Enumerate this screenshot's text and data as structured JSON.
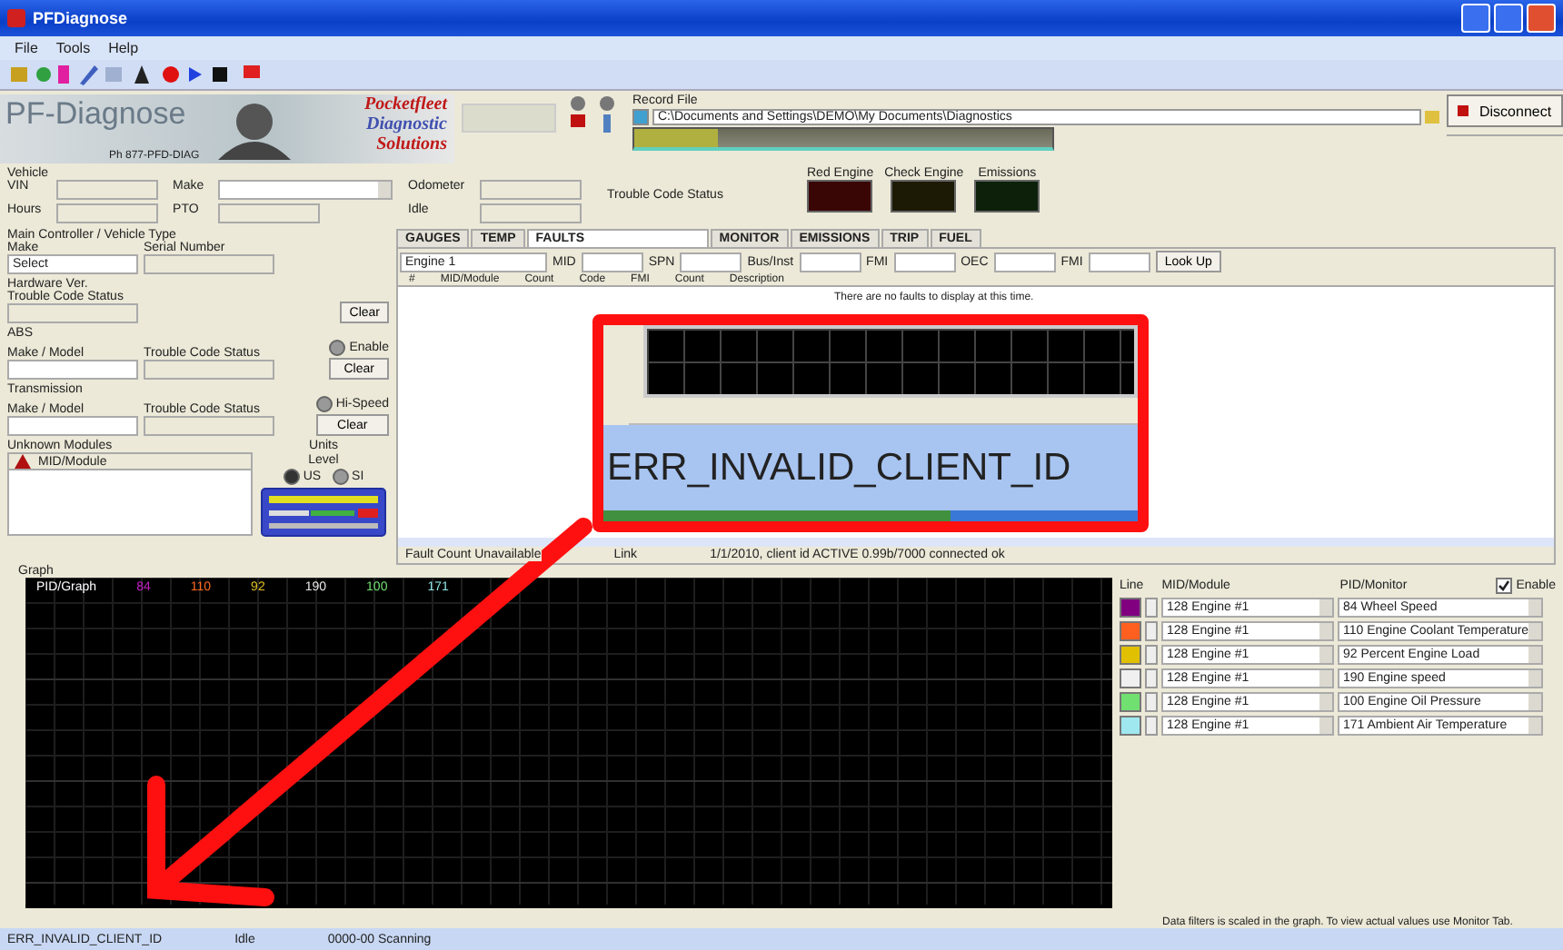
{
  "window": {
    "title": "PFDiagnose"
  },
  "menu": [
    "File",
    "Tools",
    "Help"
  ],
  "logo": {
    "title": "PF-Diagnose",
    "brand": [
      "Pocketfleet",
      "Diagnostic",
      "Solutions"
    ],
    "phone": "Ph 877-PFD-DIAG"
  },
  "record": {
    "label": "Record File",
    "checked": true,
    "path": "C:\\Documents and Settings\\DEMO\\My Documents\\Diagnostics",
    "level": 0.2
  },
  "disconnect_button": "Disconnect",
  "vehicle": {
    "group": "Vehicle",
    "fields": [
      {
        "label": "VIN",
        "kind": "text"
      },
      {
        "label": "Make",
        "kind": "select"
      },
      {
        "label": "Odometer",
        "kind": "text"
      },
      {
        "label": "Hours",
        "kind": "text"
      },
      {
        "label": "PTO",
        "kind": "text"
      },
      {
        "label": "Idle",
        "kind": "text"
      }
    ],
    "status_label": "Trouble Code Status"
  },
  "lamps": [
    {
      "label": "Red Engine",
      "color": "#3a0505"
    },
    {
      "label": "Check Engine",
      "color": "#1c1a05"
    },
    {
      "label": "Emissions",
      "color": "#0c200a"
    }
  ],
  "controllers": [
    {
      "title": "Main Controller / Vehicle Type",
      "label_a": "Make",
      "value_a": "Select",
      "label_b": "Serial Number"
    },
    {
      "title": "Hardware Ver.",
      "label_b": "Trouble Code Status",
      "button": "Clear"
    },
    {
      "title": "ABS",
      "label_a": "Make / Model",
      "label_b": "Trouble Code Status",
      "radio": "Enable",
      "radio_selected": false,
      "button": "Clear"
    },
    {
      "title": "Transmission",
      "label_a": "Make / Model",
      "label_b": "Trouble Code Status",
      "radio": "Hi-Speed",
      "radio_selected": false,
      "button": "Clear"
    }
  ],
  "unknown_modules": {
    "title": "Unknown Modules",
    "item": "MID/Module"
  },
  "units": {
    "title": "Units",
    "label": "Level",
    "options": [
      {
        "label": "US",
        "selected": true
      },
      {
        "label": "SI",
        "selected": false
      }
    ]
  },
  "tabs": [
    {
      "label": "GAUGES",
      "selected": false
    },
    {
      "label": "TEMP",
      "selected": false
    },
    {
      "label": "FAULTS",
      "selected": true
    },
    {
      "label": "MONITOR",
      "selected": false
    },
    {
      "label": "EMISSIONS",
      "selected": false
    },
    {
      "label": "TRIP",
      "selected": false
    },
    {
      "label": "FUEL",
      "selected": false
    }
  ],
  "filter": {
    "module": "Engine 1",
    "fields": [
      "MID",
      "SPN",
      "Bus/Inst",
      "FMI",
      "OEC",
      "FMI"
    ],
    "button": "Look Up"
  },
  "columns": [
    "#",
    "MID/Module",
    "Count",
    "Code",
    "FMI",
    "Count",
    "Description"
  ],
  "empty_message": "There are no faults to display at this time.",
  "fault_status": {
    "count": "Fault Count Unavailable",
    "link": "Link",
    "message": "1/1/2010, client id ACTIVE 0.99b/7000 connected ok"
  },
  "annotation": {
    "text": "ERR_INVALID_CLIENT_ID",
    "level": 0.65
  },
  "graph": {
    "label": "Graph",
    "legend": [
      {
        "label": "PID/Graph",
        "color": "#ffffff"
      },
      {
        "label": "84",
        "color": "#c020c0"
      },
      {
        "label": "110",
        "color": "#ff6a20"
      },
      {
        "label": "92",
        "color": "#e0c020"
      },
      {
        "label": "190",
        "color": "#e8e8e8"
      },
      {
        "label": "100",
        "color": "#70e070"
      },
      {
        "label": "171",
        "color": "#90e8e8"
      }
    ]
  },
  "graph_config": {
    "headers": [
      "Line",
      "MID/Module",
      "PID/Monitor"
    ],
    "enable": {
      "label": "Enable",
      "checked": true
    },
    "rows": [
      {
        "color": "#800080",
        "module": "128 Engine #1",
        "pid": "84 Wheel Speed"
      },
      {
        "color": "#ff6020",
        "module": "128 Engine #1",
        "pid": "110 Engine Coolant Temperature"
      },
      {
        "color": "#e0c000",
        "module": "128 Engine #1",
        "pid": "92 Percent Engine Load"
      },
      {
        "color": "#f0f0f0",
        "module": "128 Engine #1",
        "pid": "190 Engine speed"
      },
      {
        "color": "#70e070",
        "module": "128 Engine #1",
        "pid": "100 Engine Oil Pressure"
      },
      {
        "color": "#a0e8f0",
        "module": "128 Engine #1",
        "pid": "171 Ambient Air Temperature"
      }
    ],
    "note": "Data filters is scaled in the graph. To view actual values use Monitor Tab."
  },
  "status_bar": [
    "ERR_INVALID_CLIENT_ID",
    "Idle",
    "0000-00 Scanning"
  ]
}
